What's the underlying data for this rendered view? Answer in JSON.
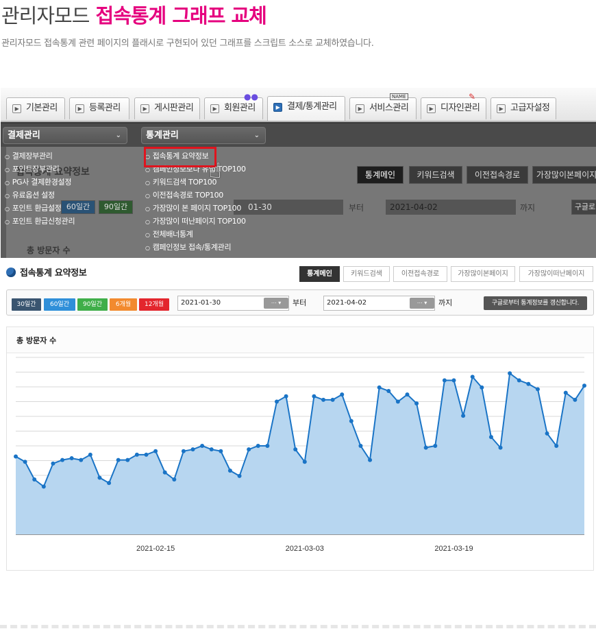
{
  "header": {
    "title_prefix": "관리자모드",
    "title_highlight": "접속통계 그래프 교체",
    "subtitle": "관리자모드 접속통계 관련 페이지의 플래시로 구현되어 있던 그래프를 스크립트 소스로 교체하였습니다."
  },
  "colors": {
    "highlight": "#e5007e",
    "accent": "#2f6fb5",
    "chart_line": "#1a74c6",
    "chart_fill": "#b7d6f0"
  },
  "tabs": [
    {
      "label": "기본관리",
      "icon": "arrow-right-icon"
    },
    {
      "label": "등록관리",
      "icon": "arrow-right-icon"
    },
    {
      "label": "게시판관리",
      "icon": "arrow-right-icon"
    },
    {
      "label": "회원관리",
      "icon": "arrow-right-icon"
    },
    {
      "label": "결제/통계관리",
      "icon": "arrow-right-icon",
      "active": true
    },
    {
      "label": "서비스관리",
      "icon": "arrow-right-icon"
    },
    {
      "label": "디자인관리",
      "icon": "arrow-right-icon"
    },
    {
      "label": "고급자설정",
      "icon": "arrow-right-icon"
    }
  ],
  "deco_badge": "NAME",
  "dropdowns": {
    "payment": "결제관리",
    "stats": "통계관리"
  },
  "payment_menu": [
    "결제장부관리",
    "포인트장부관리",
    "PG사 결제환경설정",
    "유료옵션 설정",
    "포인트 환급설정",
    "포인트 환급신청관리"
  ],
  "stats_menu": [
    "접속통계 요약정보",
    "캠페인정보보다 유입 TOP100",
    "키워드검색 TOP100",
    "이전접속경로 TOP100",
    "가장많이 본 페이지 TOP100",
    "가장많이 떠난페이지 TOP100",
    "전체배너통계",
    "캠페인정보 접속/통계관리"
  ],
  "ghost": {
    "heading": "접속통계 요약정보",
    "buttons": [
      "통계메인",
      "키워드검색",
      "이전접속경로",
      "가장많이본페이지"
    ],
    "periods": [
      "60일간",
      "90일간"
    ],
    "date_fragment": "01-30",
    "date_to": "2021-04-02",
    "from_label": "부터",
    "to_label": "까지",
    "google_btn": "구글로",
    "total_visitors": "총 방문자 수"
  },
  "stats": {
    "title": "접속통계 요약정보",
    "tab_buttons": [
      "통계메인",
      "키워드검색",
      "이전접속경로",
      "가장많이본페이지",
      "가장많이떠난페이지"
    ],
    "periods": [
      {
        "label": "30일간",
        "color": "#3a5570"
      },
      {
        "label": "60일간",
        "color": "#2f8fd9"
      },
      {
        "label": "90일간",
        "color": "#3fae49"
      },
      {
        "label": "6개월",
        "color": "#f28a2e"
      },
      {
        "label": "12개월",
        "color": "#e3262d"
      }
    ],
    "date_from": "2021-01-30",
    "date_to": "2021-04-02",
    "from_label": "부터",
    "to_label": "까지",
    "calendar_icon": "calendar-icon",
    "refresh_button": "구글로부터 통계정보를 갱신합니다.",
    "panel_title": "총 방문자 수"
  },
  "chart_data": {
    "type": "area",
    "title": "총 방문자 수",
    "x_ticks": [
      "2021-02-15",
      "2021-03-03",
      "2021-03-19"
    ],
    "tick_index": [
      15,
      31,
      47
    ],
    "ylim": [
      0,
      100
    ],
    "grid": true,
    "values": [
      44,
      41,
      31,
      27,
      40,
      42,
      43,
      42,
      45,
      32,
      29,
      42,
      42,
      45,
      45,
      47,
      35,
      31,
      47,
      48,
      50,
      48,
      47,
      36,
      33,
      48,
      50,
      50,
      75,
      78,
      48,
      41,
      78,
      76,
      76,
      79,
      64,
      50,
      42,
      83,
      81,
      75,
      79,
      74,
      49,
      50,
      87,
      87,
      67,
      89,
      83,
      55,
      49,
      91,
      87,
      85,
      82,
      57,
      50,
      80,
      76,
      84
    ],
    "line_color": "#1a74c6",
    "fill_color": "#b7d6f0"
  }
}
